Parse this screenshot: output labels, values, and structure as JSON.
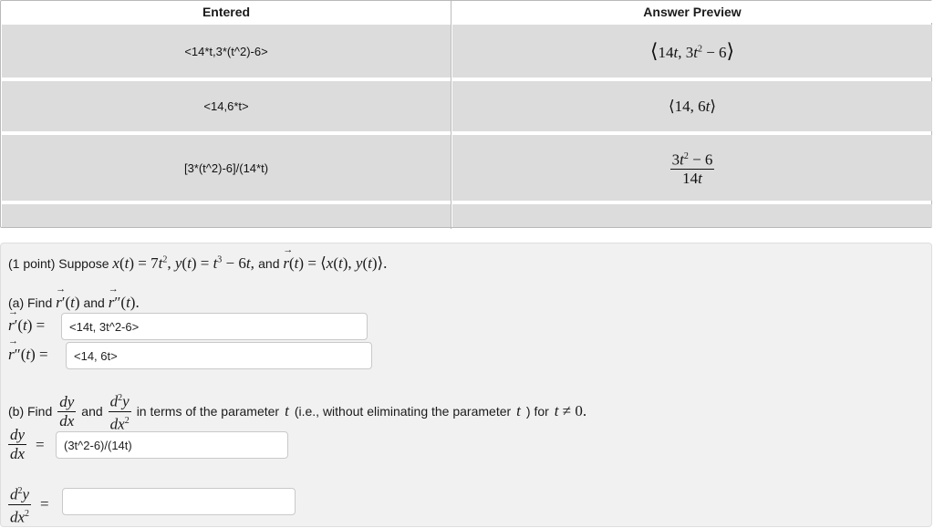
{
  "results": {
    "headers": {
      "entered": "Entered",
      "preview": "Answer Preview"
    },
    "rows": [
      {
        "entered": "<14*t,3*(t^2)-6>"
      },
      {
        "entered": "<14,6*t>"
      },
      {
        "entered": "[3*(t^2)-6]/(14*t)"
      },
      {
        "entered": ""
      }
    ]
  },
  "problem": {
    "points": "(1 point) Suppose",
    "and_word": "and",
    "part_a": {
      "label": "(a) Find",
      "and": "and",
      "r_prime_value": "<14t, 3t^2-6>",
      "r_double_prime_value": "<14, 6t>"
    },
    "part_b": {
      "label": "(b) Find",
      "and": "and",
      "terms_text": "in terms of the parameter",
      "ie_text": "(i.e., without eliminating the parameter",
      "for_text": ") for",
      "dydx_value": "(3t^2-6)/(14t)",
      "d2ydx2_value": ""
    }
  }
}
